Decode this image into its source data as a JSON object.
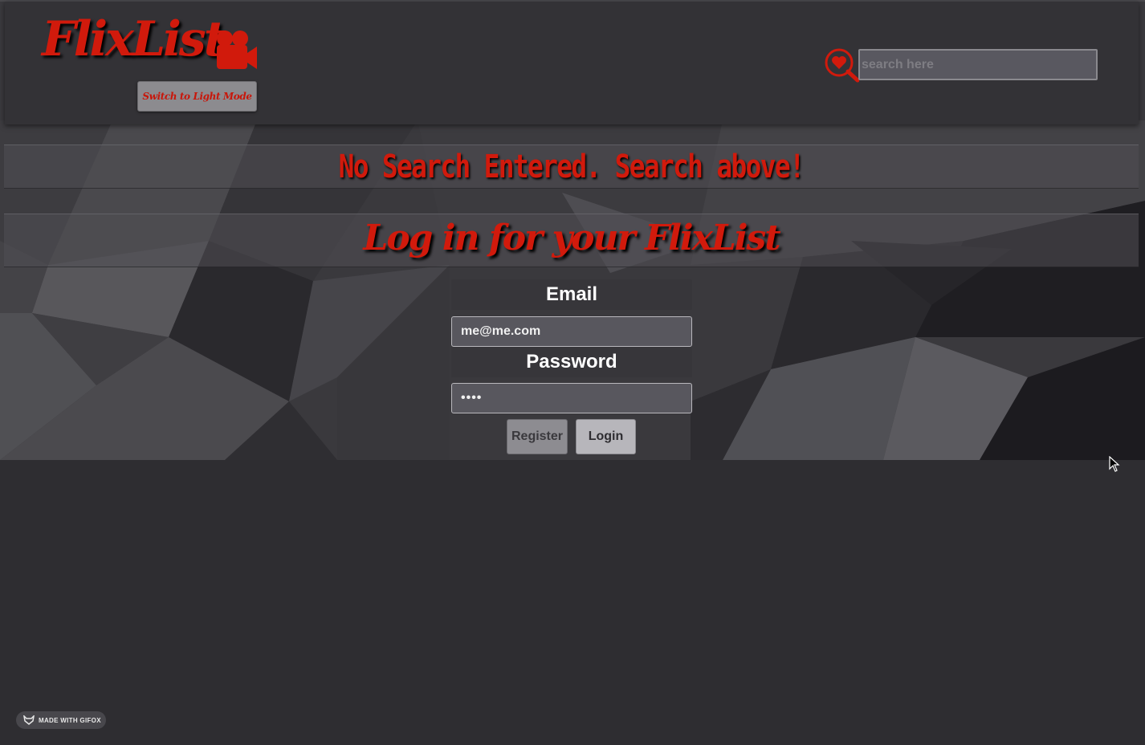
{
  "header": {
    "logo_text": "FlixList",
    "mode_button_label": "Switch to Light Mode",
    "search_placeholder": "search here"
  },
  "banners": {
    "no_search_message": "No Search Entered. Search above!",
    "login_title": "Log in for your FlixList"
  },
  "login_form": {
    "email_label": "Email",
    "email_value": "me@me.com",
    "password_label": "Password",
    "password_value": "••••",
    "register_label": "Register",
    "login_label": "Login"
  },
  "footer": {
    "badge_text": "MADE WITH GIFOX"
  },
  "colors": {
    "accent_red": "#d11a0c",
    "background": "#2e2d31",
    "header_bg": "#333236"
  },
  "icons": [
    "video-camera-icon",
    "heart-search-icon",
    "mouse-cursor-icon",
    "gifox-logo-icon"
  ]
}
